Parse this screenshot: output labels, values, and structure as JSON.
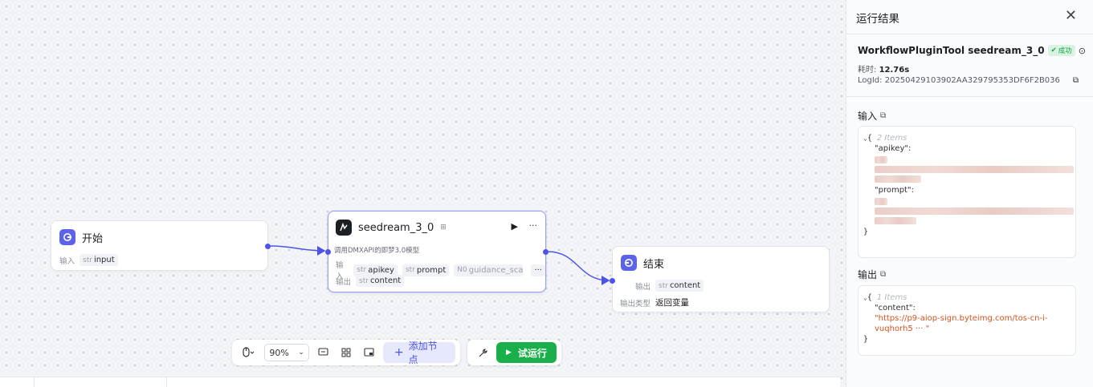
{
  "canvas": {
    "start_node": {
      "title": "开始",
      "input_label": "输入",
      "input_param": {
        "type": "str",
        "name": "input"
      }
    },
    "plugin_node": {
      "title": "seedream_3_0",
      "description": "调用DMXAPI的即梦3.0模型",
      "input_label": "输入",
      "inputs": [
        {
          "type": "str",
          "name": "apikey"
        },
        {
          "type": "str",
          "name": "prompt"
        },
        {
          "type": "N0",
          "name": "guidance_scale"
        }
      ],
      "output_label": "输出",
      "output_param": {
        "type": "str",
        "name": "content"
      },
      "more_label": "···"
    },
    "end_node": {
      "title": "结束",
      "output_label": "输出",
      "output_param": {
        "type": "str",
        "name": "content"
      },
      "output_type_label": "输出类型",
      "output_type_value": "返回变量"
    },
    "toolbar": {
      "zoom": "90%",
      "add_node_label": "添加节点",
      "run_label": "试运行"
    }
  },
  "panel": {
    "title": "运行结果",
    "run_name": "WorkflowPluginTool seedream_3_0",
    "status": "成功",
    "duration_label": "耗时:",
    "duration_value": "12.76s",
    "logid_label": "LogId:",
    "logid_value": "20250429103902AA329795353DF6F2B036",
    "input_section": "输入",
    "input_items_label": "2 Items",
    "input_keys": [
      "\"apikey\":",
      "\"prompt\":"
    ],
    "output_section": "输出",
    "output_items_label": "1 Items",
    "output_key": "\"content\":",
    "output_value_line1": "\"https://p9-aiop-sign.byteimg.com/tos-cn-i-",
    "output_value_line2": "vuqhorh5 ··· \""
  },
  "colors": {
    "accent": "#4d53e8",
    "run_green": "#19b04b",
    "success_bg": "#d9f3e2",
    "string_orange": "#d2541f"
  }
}
